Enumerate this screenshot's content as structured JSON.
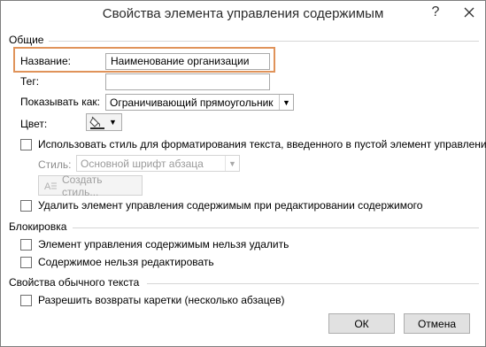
{
  "window": {
    "title": "Свойства элемента управления содержимым",
    "help_icon": "question-icon",
    "close_icon": "close-icon"
  },
  "general": {
    "section_title": "Общие",
    "name_label": "Название:",
    "name_value": "Наименование организации",
    "tag_label": "Тег:",
    "tag_value": "",
    "show_as_label": "Показывать как:",
    "show_as_value": "Ограничивающий прямоугольник",
    "color_label": "Цвет:",
    "use_style_label": "Использовать стиль для форматирования текста, введенного в пустой элемент управления",
    "use_style_checked": false,
    "style_label": "Стиль:",
    "style_value": "Основной шрифт абзаца",
    "create_style_label": "Создать стиль...",
    "remove_control_label": "Удалить элемент управления содержимым при редактировании содержимого",
    "remove_control_checked": false
  },
  "locking": {
    "section_title": "Блокировка",
    "cannot_delete_label": "Элемент управления содержимым нельзя удалить",
    "cannot_delete_checked": false,
    "cannot_edit_label": "Содержимое нельзя редактировать",
    "cannot_edit_checked": false
  },
  "plain_text": {
    "section_title": "Свойства обычного текста",
    "allow_carriage_label": "Разрешить возвраты каретки (несколько абзацев)",
    "allow_carriage_checked": false
  },
  "buttons": {
    "ok": "ОК",
    "cancel": "Отмена"
  },
  "colors": {
    "highlight": "#e0935a",
    "disabled_text": "#8c8c8c"
  }
}
